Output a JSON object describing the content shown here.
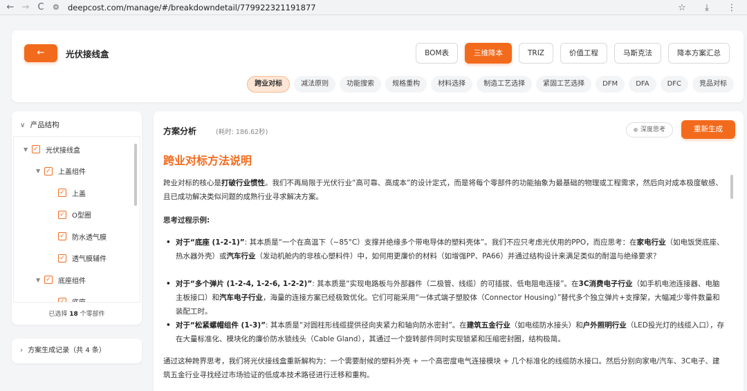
{
  "browser": {
    "url": "deepcost.com/manage/#/breakdowndetail/779922321191877",
    "back_icon": "←",
    "forward_icon": "→",
    "reload_icon": "C",
    "site_icon": "⚙",
    "star_icon": "☆",
    "download_icon": "⤓",
    "menu_icon": "⋮"
  },
  "header": {
    "back_icon": "←",
    "title": "光伏接线盒",
    "tool_buttons": [
      "BOM表",
      "三维降本",
      "TRIZ",
      "价值工程",
      "马斯克法",
      "降本方案汇总"
    ],
    "active_tool": "三维降本",
    "method_tabs": [
      "跨业对标",
      "减法原则",
      "功能搜索",
      "规格重构",
      "材料选择",
      "制造工艺选择",
      "紧固工艺选择",
      "DFM",
      "DFA",
      "DFC",
      "竞品对标"
    ],
    "active_method": "跨业对标"
  },
  "structure": {
    "title": "产品结构",
    "tree": [
      {
        "label": "光伏接线盒",
        "level": 0,
        "expanded": true,
        "checked": true
      },
      {
        "label": "上盖组件",
        "level": 1,
        "expanded": true,
        "checked": true
      },
      {
        "label": "上盖",
        "level": 2,
        "checked": true
      },
      {
        "label": "O型圈",
        "level": 2,
        "checked": true
      },
      {
        "label": "防水透气膜",
        "level": 2,
        "checked": true
      },
      {
        "label": "透气膜辅件",
        "level": 2,
        "checked": true
      },
      {
        "label": "底座组件",
        "level": 1,
        "expanded": true,
        "checked": true
      },
      {
        "label": "底座",
        "level": 2,
        "checked": true
      }
    ],
    "footer_prefix": "已选择",
    "selected_count": "18",
    "footer_suffix": "个零部件"
  },
  "history": {
    "label": "方案生成记录（共 4 条）"
  },
  "main": {
    "title": "方案分析",
    "elapsed": "(耗时: 186.62秒)",
    "deep_think": "深度思考",
    "regenerate": "重新生成",
    "section_title": "跨业对标方法说明",
    "intro_a": "跨业对标的核心是",
    "intro_b": "打破行业惯性",
    "intro_c": "。我们不再局限于光伏行业“高可靠、高成本”的设计定式，而是将每个零部件的功能抽象为最基础的物理或工程需求，然后向对成本极度敏感、且已成功解决类似问题的成熟行业寻求解决方案。",
    "thinking_title": "思考过程示例:",
    "b1_head": "对于“底座 (1-2-1)”",
    "b1_a": ": 其本质是“一个在高温下（~85°C）支撑并绝缘多个带电导体的塑料壳体”。我们不应只考虑光伏用的PPO，而应思考：在",
    "b1_b": "家电行业",
    "b1_c": "（如电饭煲底座、热水器外壳）或",
    "b1_d": "汽车行业",
    "b1_e": "（发动机舱内的非核心塑料件）中，如何用更廉价的材料（如增强PP、PA66）并通过结构设计来满足类似的耐温与绝缘要求？",
    "b2_head": "对于“多个弹片 (1-2-4, 1-2-6, 1-2-2)”",
    "b2_a": ": 其本质是“实现电路板与外部器件（二极管、线缆）的可插拔、低电阻电连接”。在",
    "b2_b": "3C消费电子行业",
    "b2_c": "（如手机电池连接器、电脑主板接口）和",
    "b2_d": "汽车电子行业",
    "b2_e": "，海量的连接方案已经极致优化。它们可能采用“一体式端子塑胶体（Connector Housing）”替代多个独立弹片+支撑架，大幅减少零件数量和装配工时。",
    "b3_head": "对于“松紧螺帽组件 (1-3)”",
    "b3_a": ": 其本质是“对圆柱形线缆提供径向夹紧力和轴向防水密封”。在",
    "b3_b": "建筑五金行业",
    "b3_c": "（如电缆防水接头）和",
    "b3_d": "户外照明行业",
    "b3_e": "（LED投光灯的线缆入口），存在大量标准化、模块化的廉价防水锁线头（Cable Gland），其通过一个旋转部件同时实现锁紧和压缩密封圈，结构极简。",
    "conclusion": "通过这种跨界思考，我们将光伏接线盒重新解构为：一个需要耐候的塑料外壳 + 一个高密度电气连接模块 + 几个标准化的线缆防水接口。然后分别向家电/汽车、3C电子、建筑五金行业寻找经过市场验证的低成本技术路径进行迁移和重构。"
  }
}
